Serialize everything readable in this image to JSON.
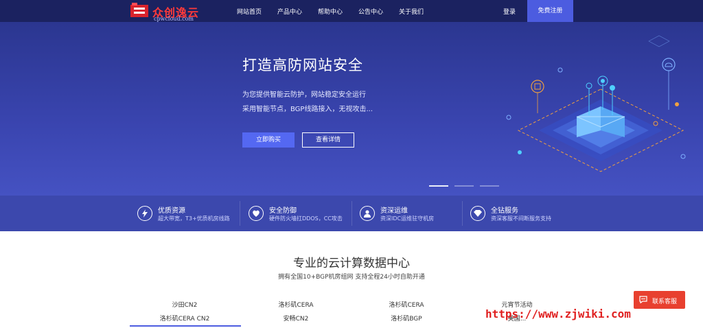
{
  "brand": {
    "name": "众创逸云",
    "domain": "cpwcloud.com"
  },
  "nav": {
    "links": [
      "网站首页",
      "产品中心",
      "帮助中心",
      "公告中心",
      "关于我们"
    ],
    "login": "登录",
    "register": "免费注册"
  },
  "hero": {
    "title": "打造高防网站安全",
    "lines": [
      "为您提供智能云防护，网站稳定安全运行",
      "采用智能节点，BGP线路接入，无视攻击..."
    ],
    "buy_label": "立即购买",
    "detail_label": "查看详情",
    "slide_count": 3,
    "active_slide": 1
  },
  "features": [
    {
      "title": "优质资源",
      "desc": "超大带宽，T3+优质机房线路",
      "icon": "lightning-icon"
    },
    {
      "title": "安全防御",
      "desc": "硬件防火墙扛DDOS，CC攻击",
      "icon": "heart-shield-icon"
    },
    {
      "title": "资深运维",
      "desc": "资深IDC运维驻守机房",
      "icon": "user-icon"
    },
    {
      "title": "全钻服务",
      "desc": "资深客服不间断服务支持",
      "icon": "diamond-icon"
    }
  ],
  "main": {
    "title": "专业的云计算数据中心",
    "subtitle": "拥有全国10+BGP机房组网 支持全程24小时自助开通",
    "tabs_row1": [
      "沙田CN2",
      "洛杉矶CERA",
      "洛杉矶CERA",
      "元宵节活动"
    ],
    "tabs_row2": [
      "洛杉矶CERA CN2",
      "安畅CN2",
      "洛杉矶BGP",
      "美国..."
    ],
    "active_tab": "洛杉矶CERA CN2"
  },
  "contact": {
    "label": "联系客服"
  },
  "watermark": "https://www.zjwiki.com",
  "colors": {
    "nav_bg": "#1b2260",
    "hero_bg": "#3a45b0",
    "accent": "#4c5ce0",
    "contact_red": "#e8402f"
  }
}
